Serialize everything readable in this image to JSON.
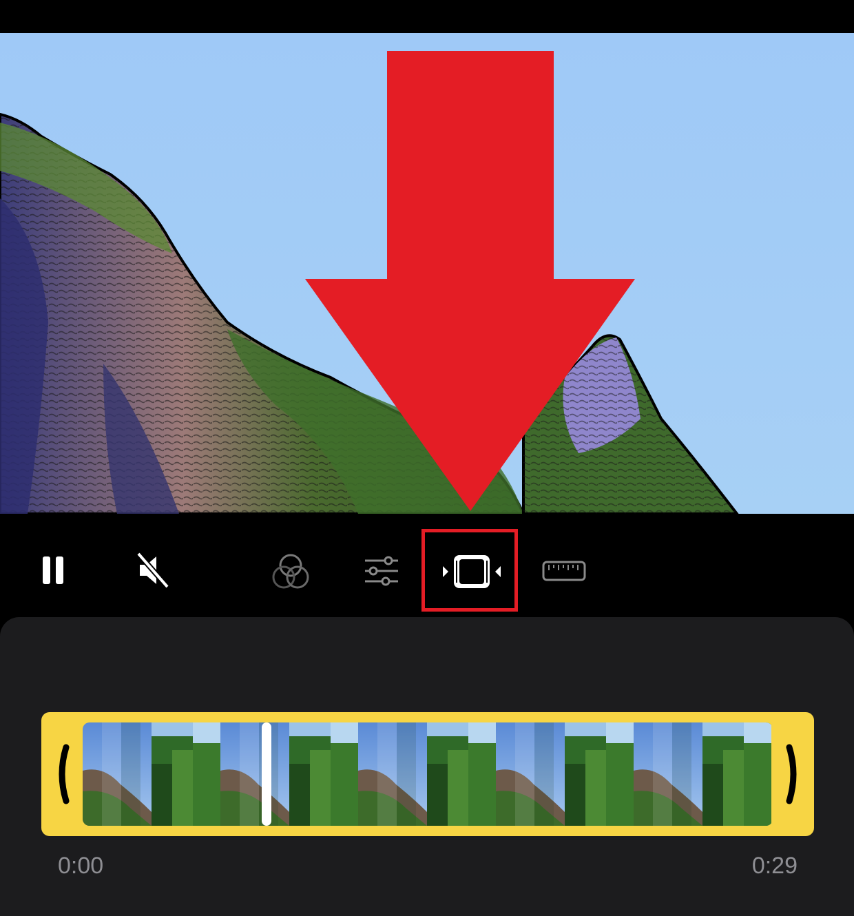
{
  "toolbar": {
    "playback": {
      "icon": "pause-icon"
    },
    "audio": {
      "icon": "speaker-muted-icon"
    },
    "tools": [
      {
        "id": "filters",
        "icon": "filters-icon"
      },
      {
        "id": "adjust",
        "icon": "sliders-icon"
      },
      {
        "id": "trim",
        "icon": "trim-video-icon",
        "highlighted": true
      },
      {
        "id": "crop",
        "icon": "ruler-icon"
      }
    ]
  },
  "annotation": {
    "arrow_color": "#e41d25",
    "points_to": "trim"
  },
  "timeline": {
    "start_time": "0:00",
    "end_time": "0:29",
    "accent_color": "#f7d544"
  }
}
